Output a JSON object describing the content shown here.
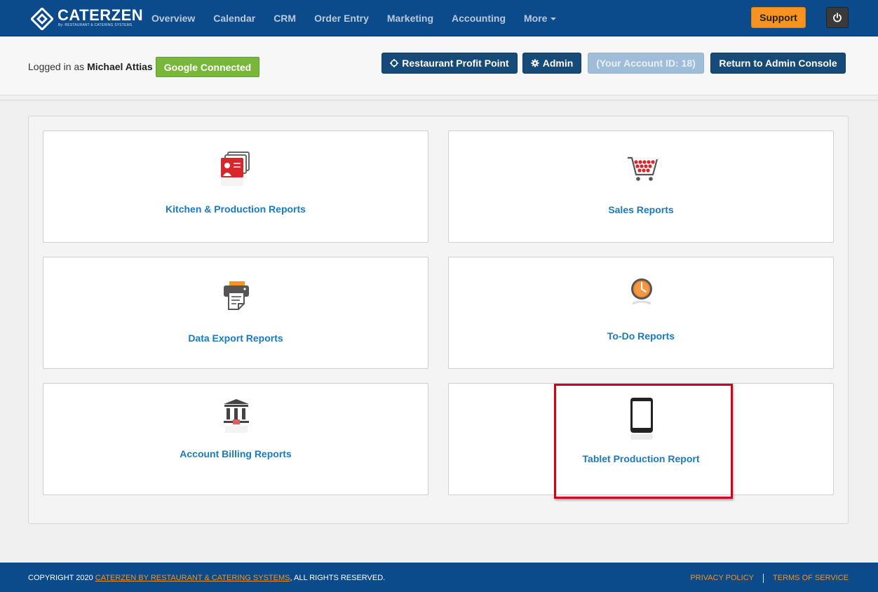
{
  "nav": {
    "brand": "CATERZEN",
    "tagline": "By: RESTAURANT & CATERING SYSTEMS",
    "links": [
      "Overview",
      "Calendar",
      "CRM",
      "Order Entry",
      "Marketing",
      "Accounting"
    ],
    "more_label": "More",
    "support_label": "Support",
    "power_icon": "power-icon"
  },
  "subheader": {
    "logged_prefix": "Logged in as",
    "user_name": "Michael Attias",
    "google_label": "Google Connected",
    "rpp_label": "Restaurant Profit Point",
    "admin_label": "Admin",
    "account_label": "(Your Account ID: 18)",
    "return_label": "Return to Admin Console"
  },
  "cards": [
    {
      "label": "Kitchen & Production Reports",
      "icon": "kitchen-reports-icon"
    },
    {
      "label": "Sales Reports",
      "icon": "shopping-cart-icon"
    },
    {
      "label": "Data Export Reports",
      "icon": "printer-icon"
    },
    {
      "label": "To-Do Reports",
      "icon": "clock-icon"
    },
    {
      "label": "Account Billing Reports",
      "icon": "bank-icon"
    },
    {
      "label": "Tablet Production Report",
      "icon": "tablet-icon"
    }
  ],
  "footer": {
    "copyright_prefix": "COPYRIGHT 2020",
    "company_link": "CATERZEN BY RESTAURANT & CATERING SYSTEMS",
    "copyright_suffix": ", ALL RIGHTS RESERVED.",
    "privacy_label": "PRIVACY POLICY",
    "terms_label": "TERMS OF SERVICE"
  },
  "colors": {
    "nav_bg": "#0b4a8b",
    "accent_orange": "#f7931e",
    "button_navy": "#154a79",
    "link_blue": "#1a7abf",
    "google_green": "#78b739",
    "highlight_red": "#d0021b"
  }
}
